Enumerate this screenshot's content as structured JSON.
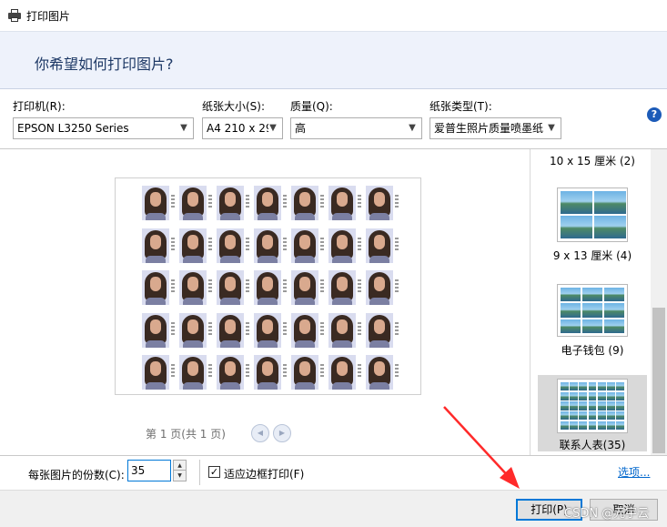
{
  "window": {
    "title": "打印图片"
  },
  "header": {
    "question": "你希望如何打印图片?"
  },
  "settings": {
    "printer": {
      "label": "打印机(R):",
      "value": "EPSON L3250 Series"
    },
    "paper_size": {
      "label": "纸张大小(S):",
      "value": "A4 210 x 29"
    },
    "quality": {
      "label": "质量(Q):",
      "value": "高"
    },
    "paper_type": {
      "label": "纸张类型(T):",
      "value": "爱普生照片质量喷墨纸"
    }
  },
  "preview": {
    "page_info": "第 1 页(共 1 页)",
    "rows": 5,
    "cols": 7
  },
  "layouts": [
    {
      "label": "10 x 15 厘米 (2)"
    },
    {
      "label": "9 x 13 厘米 (4)"
    },
    {
      "label": "电子钱包 (9)"
    },
    {
      "label": "联系人表(35)",
      "selected": true
    }
  ],
  "copies": {
    "label": "每张图片的份数(C):",
    "value": "35"
  },
  "fit": {
    "label": "适应边框打印(F)",
    "checked": true
  },
  "options_link": "选项...",
  "buttons": {
    "print": "打印(P)",
    "cancel": "取消"
  },
  "watermark": "CSDN @元宇云",
  "colors": {
    "accent": "#0078d7",
    "header_bg": "#eef2fb",
    "arrow": "#ff2a2a",
    "link": "#0066cc"
  }
}
